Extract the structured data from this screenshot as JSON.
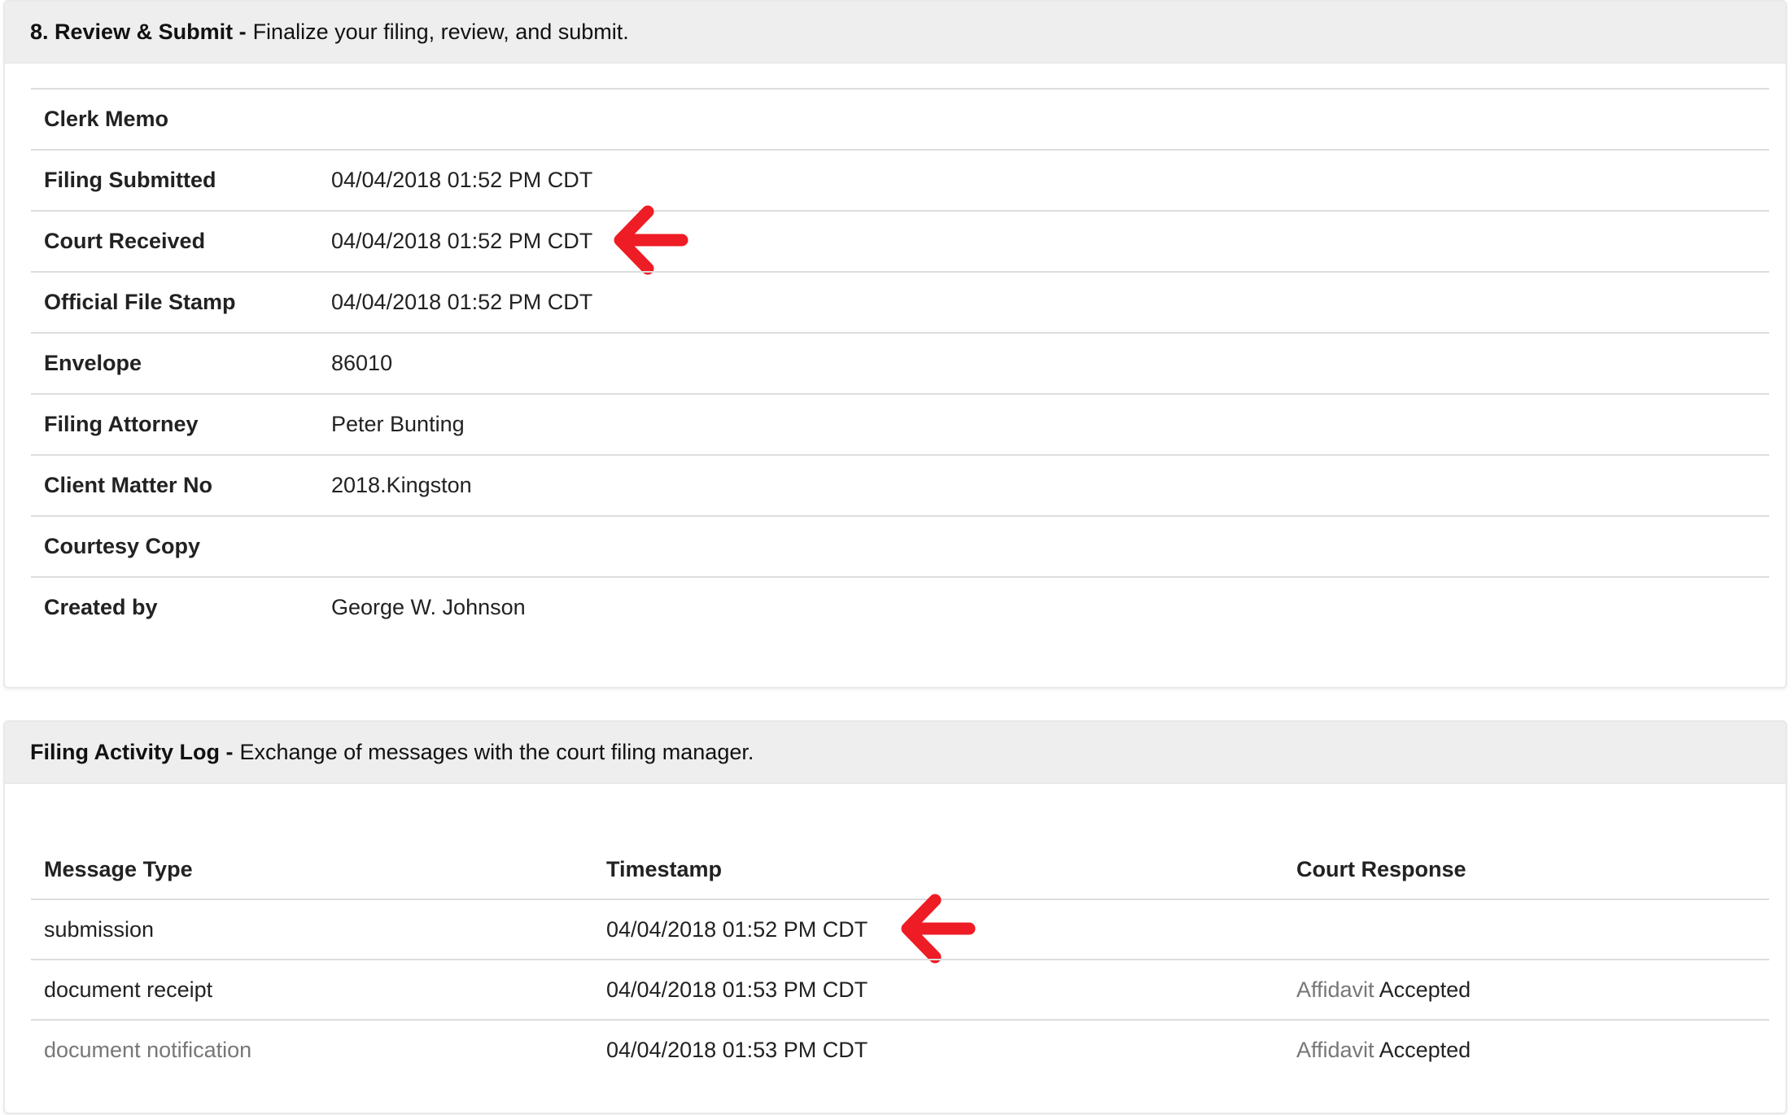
{
  "review": {
    "step_title": "8. Review & Submit -",
    "step_desc": "Finalize your filing, review, and submit.",
    "rows": [
      {
        "label": "Clerk Memo",
        "value": ""
      },
      {
        "label": "Filing Submitted",
        "value": "04/04/2018 01:52 PM CDT"
      },
      {
        "label": "Court Received",
        "value": "04/04/2018 01:52 PM CDT"
      },
      {
        "label": "Official File Stamp",
        "value": "04/04/2018 01:52 PM CDT"
      },
      {
        "label": "Envelope",
        "value": "86010"
      },
      {
        "label": "Filing Attorney",
        "value": "Peter Bunting"
      },
      {
        "label": "Client Matter No",
        "value": "2018.Kingston"
      },
      {
        "label": "Courtesy Copy",
        "value": ""
      },
      {
        "label": "Created by",
        "value": "George W. Johnson"
      }
    ]
  },
  "activity_log": {
    "title": "Filing Activity Log -",
    "desc": "Exchange of messages with the court filing manager.",
    "columns": [
      "Message Type",
      "Timestamp",
      "Court Response"
    ],
    "rows": [
      {
        "type": "submission",
        "timestamp": "04/04/2018 01:52 PM CDT",
        "doc": "",
        "status": ""
      },
      {
        "type": "document receipt",
        "timestamp": "04/04/2018 01:53 PM CDT",
        "doc": "Affidavit",
        "status": "Accepted"
      },
      {
        "type": "document notification",
        "timestamp": "04/04/2018 01:53 PM CDT",
        "doc": "Affidavit",
        "status": "Accepted"
      }
    ]
  },
  "icons": {
    "annotation_arrow": "red-arrow-left-icon"
  },
  "colors": {
    "arrow": "#ee1c25",
    "header_bg": "#eeeeee",
    "muted_text": "#777777",
    "row_border": "#dddddd"
  }
}
